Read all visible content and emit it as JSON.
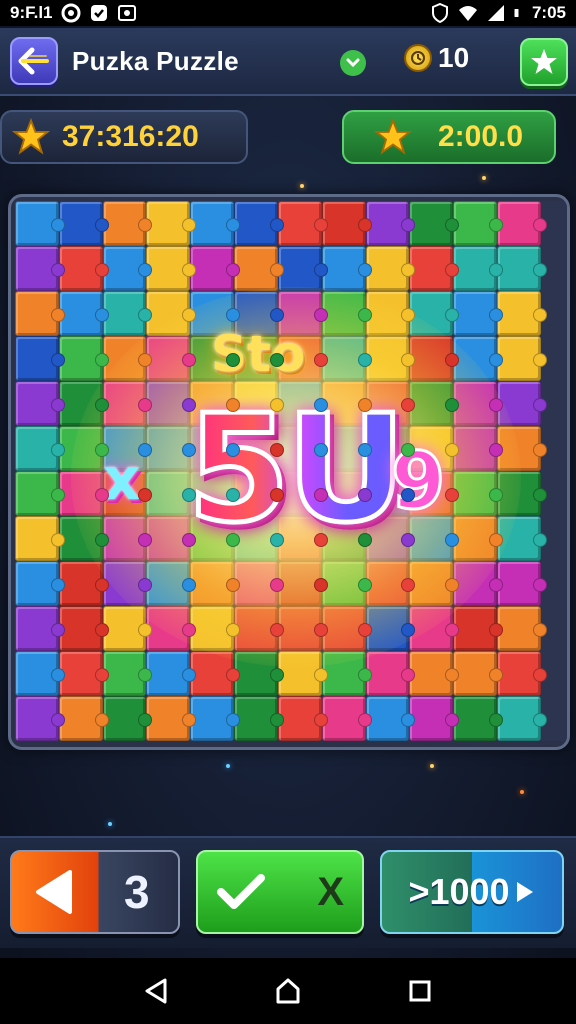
{
  "status_bar": {
    "left_text": "9:F.l1",
    "time": "7:05"
  },
  "header": {
    "back_icon": "back-arrow-icon",
    "title": "Puzka Puzzle",
    "dropdown_icon": "chevron-down-icon",
    "coin_icon": "clock-coin-icon",
    "coin_count": "10",
    "favorite_icon": "star-icon"
  },
  "timers": {
    "left_value": "37:316:20",
    "right_value": "2:00.0",
    "icon": "star-icon"
  },
  "board": {
    "overlay_small_text": "Sto",
    "overlay_x_text": "x",
    "overlay_big_text": "5U",
    "overlay_side_text": "9"
  },
  "controls": {
    "prev_icon": "left-arrow-icon",
    "prev_count": "3",
    "check_icon": "checkmark-icon",
    "check_symbol": "X",
    "next_label": ">1000"
  },
  "nav": {
    "back": "back-triangle-icon",
    "home": "home-icon",
    "recents": "recents-square-icon"
  },
  "colors": {
    "accent_green": "#3fc04a",
    "accent_orange": "#ff7a1a",
    "accent_blue": "#1a93d8",
    "timer_gold": "#ffd23a"
  }
}
